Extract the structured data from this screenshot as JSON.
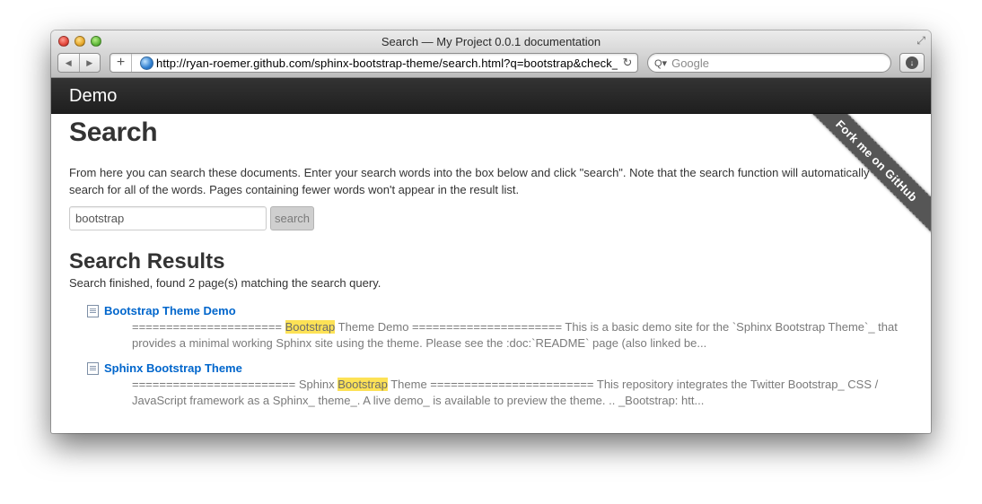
{
  "browser": {
    "window_title": "Search — My Project 0.0.1 documentation",
    "url": "http://ryan-roemer.github.com/sphinx-bootstrap-theme/search.html?q=bootstrap&check_keywords=yes&area=default",
    "search_placeholder": "Google",
    "back_icon": "◀",
    "forward_icon": "▶",
    "add_icon": "+",
    "reload_icon": "↻",
    "search_icon": "Q▾",
    "download_icon": "↓",
    "fullscreen_icon": "⤢"
  },
  "navbar": {
    "brand": "Demo"
  },
  "page": {
    "title": "Search",
    "intro": "From here you can search these documents. Enter your search words into the box below and click \"search\". Note that the search function will automatically search for all of the words. Pages containing fewer words won't appear in the result list.",
    "search_value": "bootstrap",
    "search_button": "search",
    "results_heading": "Search Results",
    "results_status": "Search finished, found 2 page(s) matching the search query."
  },
  "results": [
    {
      "title": "Bootstrap Theme Demo",
      "snippet_before": "====================== ",
      "highlight": "Bootstrap",
      "snippet_after": " Theme Demo ====================== This is a basic demo site for the `Sphinx Bootstrap Theme`_ that provides a minimal working Sphinx site using the theme. Please see the :doc:`README` page (also linked be..."
    },
    {
      "title": "Sphinx Bootstrap Theme",
      "snippet_before": "======================== Sphinx ",
      "highlight": "Bootstrap",
      "snippet_after": " Theme ======================== This repository integrates the Twitter Bootstrap_ CSS / JavaScript framework as a Sphinx_ theme_. A live demo_ is available to preview the theme. .. _Bootstrap: htt..."
    }
  ],
  "ribbon": {
    "label": "Fork me on GitHub"
  }
}
